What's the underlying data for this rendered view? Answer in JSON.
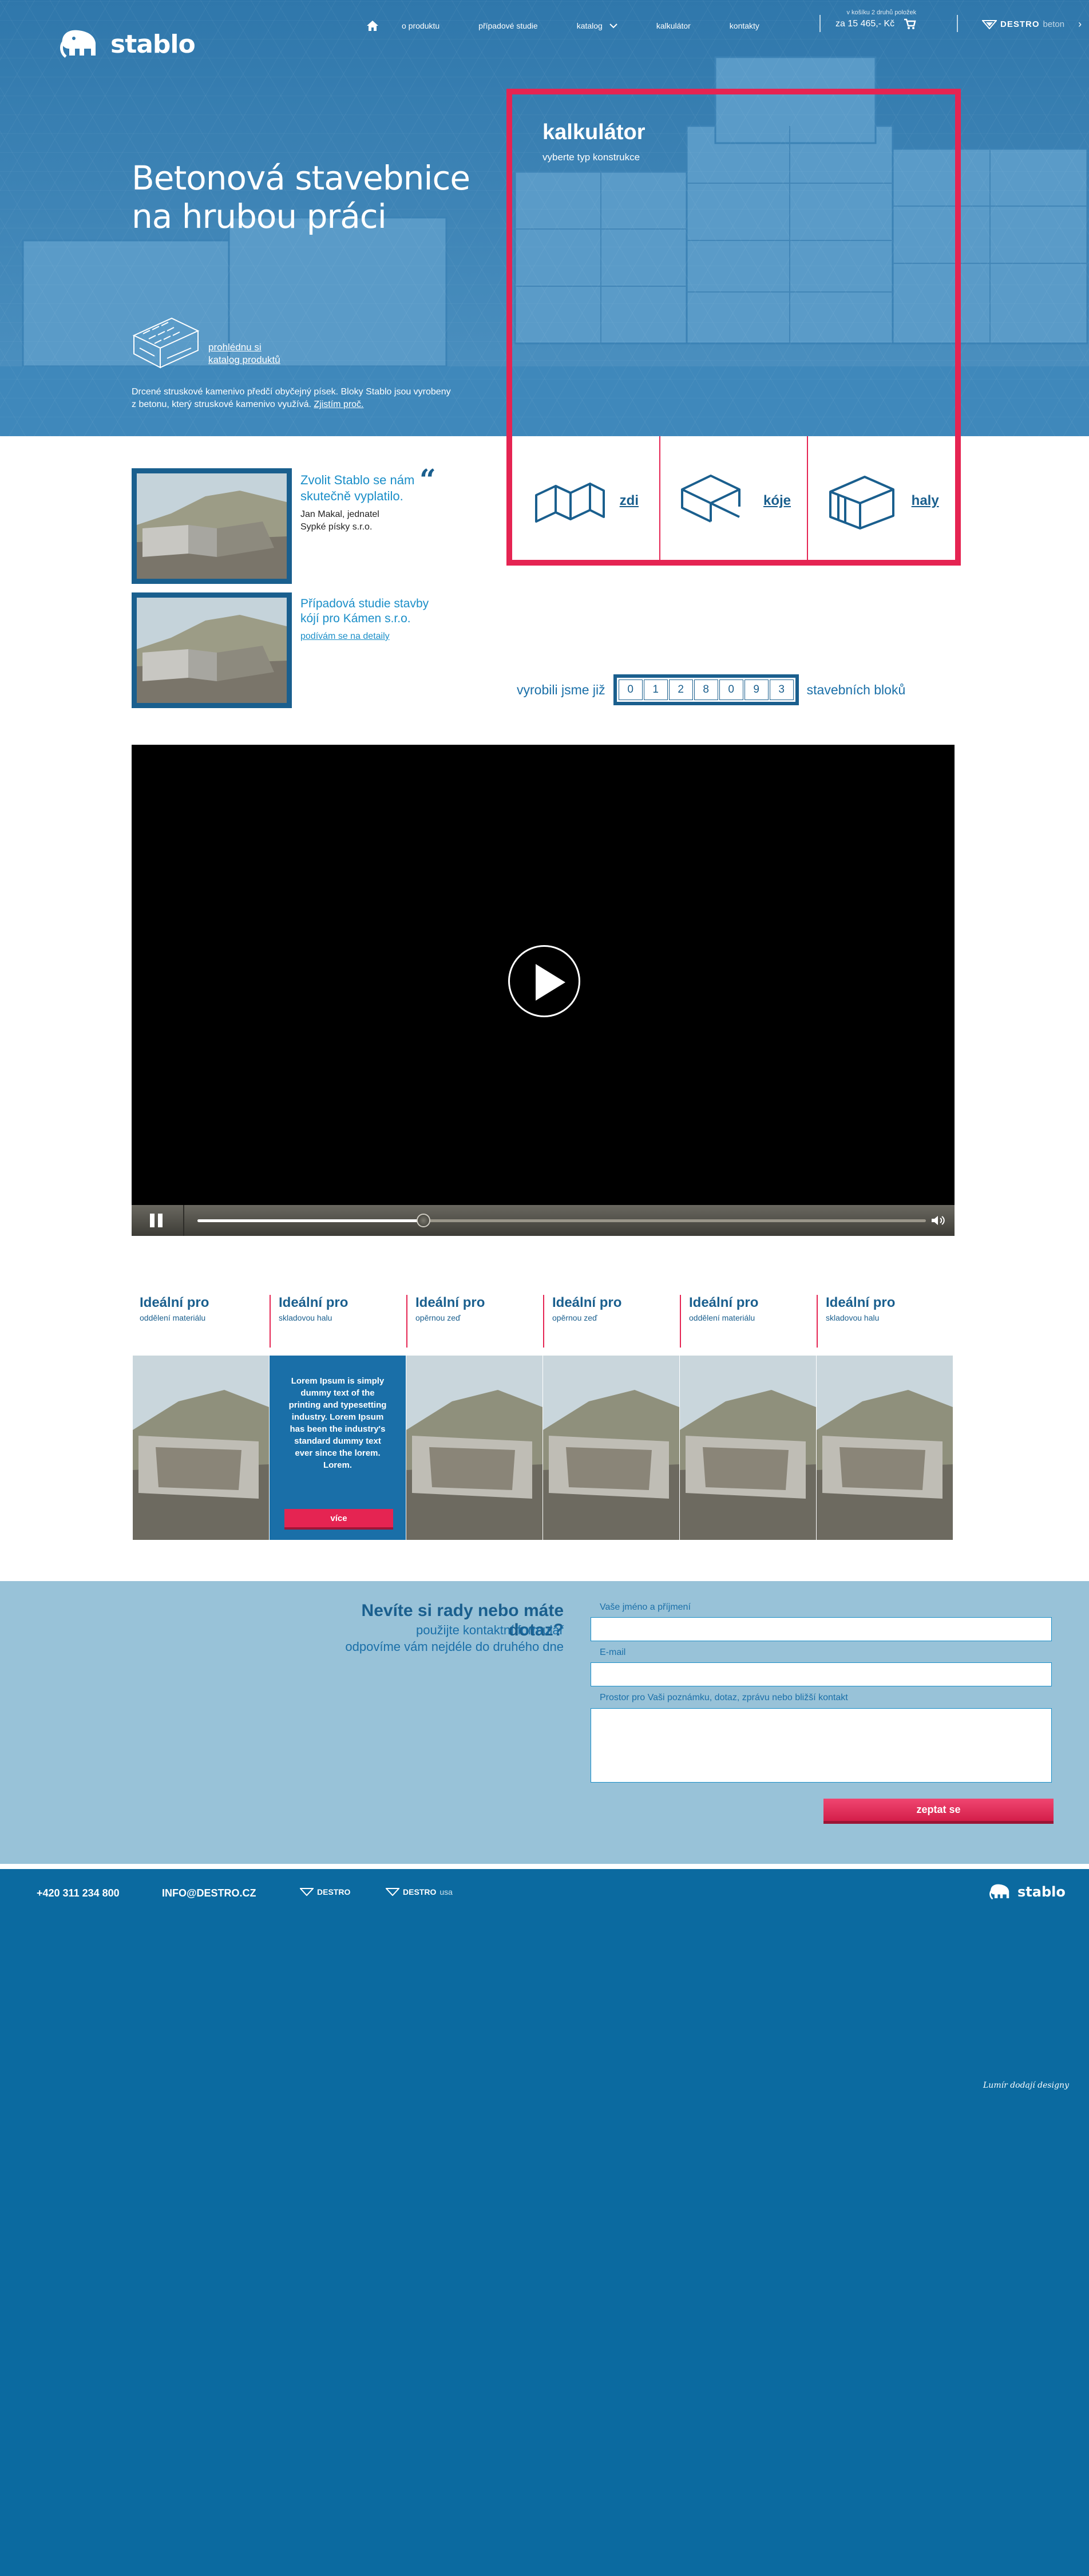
{
  "brand": {
    "name": "stablo",
    "accent": "#e52452",
    "primary": "#1a5f8e"
  },
  "nav": {
    "home_icon": "home-icon",
    "items": [
      "o produktu",
      "případové studie",
      "katalog",
      "kalkulátor",
      "kontakty"
    ],
    "cart_note": "v košíku 2 druhů položek",
    "cart_price": "za 15 465,- Kč",
    "destro_bold": "DESTRO",
    "destro_light": "beton"
  },
  "hero": {
    "headline_line1": "Betonová stavebnice",
    "headline_line2": "na hrubou práci",
    "catalog_line1": "prohlédnu si",
    "catalog_line2": "katalog produktů",
    "description": "Drcené struskové kamenivo předčí obyčejný písek. Bloky Stablo jsou vyrobeny z betonu, který struskové kamenivo využívá.",
    "description_link": "Zjistím proč."
  },
  "calculator": {
    "title": "kalkulátor",
    "subtitle": "vyberte typ konstrukce",
    "options": [
      {
        "label": "zdi",
        "icon": "wall-icon"
      },
      {
        "label": "kóje",
        "icon": "bay-icon"
      },
      {
        "label": "haly",
        "icon": "hall-icon"
      }
    ]
  },
  "testimonial": {
    "title": "Zvolit Stablo se nám skutečně vyplatilo.",
    "author": "Jan Makal, jednatel",
    "company": "Sypké písky s.r.o."
  },
  "case_study": {
    "title": "Případová studie stavby kójí pro Kámen s.r.o.",
    "link": "podívám se na detaily"
  },
  "counter": {
    "prefix": "vyrobili jsme již",
    "digits": [
      "0",
      "1",
      "2",
      "8",
      "0",
      "9",
      "3"
    ],
    "suffix": "stavebních bloků"
  },
  "video": {
    "progress": 0.31
  },
  "ideal": {
    "items": [
      {
        "title": "Ideální pro",
        "sub": "oddělení materiálu"
      },
      {
        "title": "Ideální pro",
        "sub": "skladovou halu"
      },
      {
        "title": "Ideální pro",
        "sub": "opěrnou zeď"
      },
      {
        "title": "Ideální pro",
        "sub": "opěrnou zeď"
      },
      {
        "title": "Ideální pro",
        "sub": "oddělení materiálu"
      },
      {
        "title": "Ideální pro",
        "sub": "skladovou halu"
      }
    ],
    "hover_text": "Lorem Ipsum is simply dummy text of the printing and typesetting industry. Lorem Ipsum has been the industry's standard dummy text ever since the lorem. Lorem.",
    "hover_button": "více"
  },
  "contact": {
    "title": "Nevíte si rady nebo máte dotaz?",
    "sub_line1": "použijte kontaktní formulář",
    "sub_line2": "odpovíme vám nejdéle do druhého dne",
    "name_label": "Vaše jméno a příjmení",
    "email_label": "E-mail",
    "message_label": "Prostor pro Vaši poznámku, dotaz, zprávu nebo bližší kontakt",
    "submit": "zeptat se"
  },
  "footer": {
    "phone": "+420 311 234 800",
    "email": "INFO@DESTRO.CZ",
    "destro1": "DESTRO",
    "destro2_bold": "DESTRO",
    "destro2_light": "usa",
    "logo": "stablo",
    "credit": "Lumír dodají designy"
  }
}
